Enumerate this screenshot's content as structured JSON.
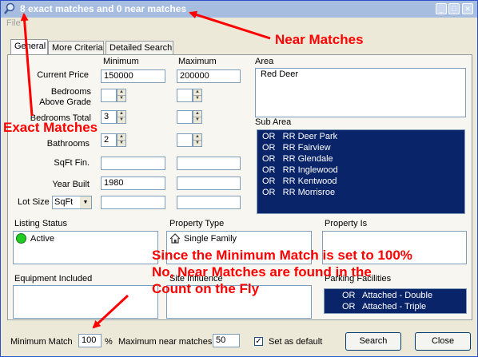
{
  "window": {
    "title": "8 exact matches and 0 near matches",
    "title_icon": "magnifier-icon"
  },
  "menu": {
    "file": "File"
  },
  "tabs": [
    {
      "label": "General",
      "active": true
    },
    {
      "label": "More Criteria",
      "active": false
    },
    {
      "label": "Detailed Search",
      "active": false
    }
  ],
  "criteria": {
    "minimum_header": "Minimum",
    "maximum_header": "Maximum",
    "current_price_label": "Current Price",
    "current_price_min": "150000",
    "current_price_max": "200000",
    "bedrooms_above_label_line1": "Bedrooms",
    "bedrooms_above_label_line2": "Above Grade",
    "bedrooms_above_min": "",
    "bedrooms_above_max": "",
    "bedrooms_total_label": "Bedrooms Total",
    "bedrooms_total_min": "3",
    "bedrooms_total_max": "",
    "bathrooms_label": "Bathrooms",
    "bathrooms_min": "2",
    "bathrooms_max": "",
    "sqft_label": "SqFt Fin.",
    "sqft_min": "",
    "sqft_max": "",
    "year_built_label": "Year Built",
    "year_built_min": "1980",
    "year_built_max": "",
    "lot_size_label": "Lot Size",
    "lot_size_unit": "SqFt",
    "lot_size_min": "",
    "lot_size_max": ""
  },
  "area": {
    "label": "Area",
    "items": [
      "Red Deer"
    ]
  },
  "sub_area": {
    "label": "Sub Area",
    "items": [
      "OR   RR Deer Park",
      "OR   RR Fairview",
      "OR   RR Glendale",
      "OR   RR Inglewood",
      "OR   RR Kentwood",
      "OR   RR Morrisroe"
    ]
  },
  "listing_status": {
    "label": "Listing Status",
    "value": "Active",
    "status_color": "#22cc22"
  },
  "property_type": {
    "label": "Property Type",
    "value": "Single Family",
    "icon": "house-icon"
  },
  "property_is": {
    "label": "Property Is"
  },
  "equipment_included": {
    "label": "Equipment Included"
  },
  "site_influence": {
    "label": "Site Influence"
  },
  "parking_facilities": {
    "label": "Parking Facilities",
    "items": [
      "OR   Attached - Double",
      "OR   Attached - Triple"
    ]
  },
  "footer": {
    "minimum_match_label": "Minimum Match",
    "minimum_match_value": "100",
    "percent_sign": "%",
    "max_near_label": "Maximum near matches",
    "max_near_value": "50",
    "set_default_label": "Set as default",
    "set_default_checked": true,
    "search_button": "Search",
    "close_button": "Close"
  },
  "annotations": {
    "near_matches": "Near Matches",
    "exact_matches": "Exact Matches",
    "note_line1": "Since the Minimum Match is set to 100%",
    "note_line2": "No, Near Matches are found in the",
    "note_line3": "Count on the Fly"
  },
  "colors": {
    "annotation": "#ff0000",
    "selection": "#0a246a",
    "titlebar": "#a7bde0"
  }
}
